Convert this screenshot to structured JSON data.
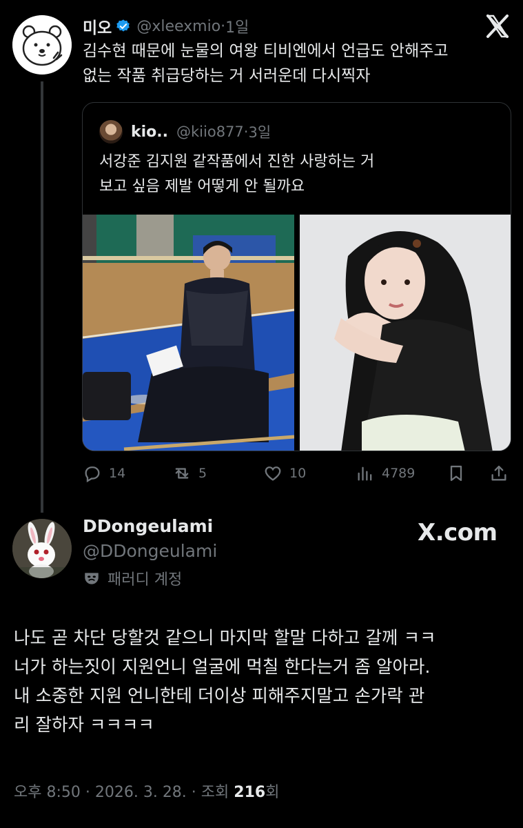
{
  "tweet1": {
    "display_name": "미오",
    "handle": "@xleexmio",
    "time": "1일",
    "text_line1": "김수현 때문에 눈물의 여왕 티비엔에서 언급도 안해주고",
    "text_line2": "없는 작품 취급당하는 거 서러운데 다시찍자",
    "quote": {
      "display_name": "kio..",
      "handle": "@kiio877",
      "time": "3일",
      "text_line1": "서강준 김지원 같작품에서 진한 사랑하는 거",
      "text_line2": "보고 싶음 제발 어떻게 안 될까요"
    },
    "actions": {
      "replies": "14",
      "reposts": "5",
      "likes": "10",
      "views": "4789"
    }
  },
  "tweet2": {
    "display_name": "DDongeulami",
    "handle": "@DDongeulami",
    "parody_label": "패러디 계정",
    "watermark": "X.com",
    "body_line1": "나도 곧 차단 당할것 같으니 마지막 할말 다하고 갈께 ㅋㅋ",
    "body_line2": "너가 하는짓이 지원언니 얼굴에 먹칠 한다는거 좀 알아라.",
    "body_line3": "내 소중한 지원 언니한테 더이상 피해주지말고 손가락 관",
    "body_line4": "리 잘하자 ㅋㅋㅋㅋ",
    "meta_prefix": "오후 8:50 · 2026. 3. 28. · 조회 ",
    "meta_views": "216",
    "meta_suffix": "회"
  },
  "colors": {
    "background": "#000000",
    "text": "#e7e9ea",
    "muted": "#71767b",
    "verified": "#1d9bf0",
    "border": "#2f3336"
  },
  "icons": [
    "bear-avatar",
    "verified-icon",
    "x-logo-icon",
    "reply-icon",
    "repost-icon",
    "like-icon",
    "views-icon",
    "bookmark-icon",
    "share-icon",
    "parody-mask-icon",
    "rabbit-avatar"
  ]
}
